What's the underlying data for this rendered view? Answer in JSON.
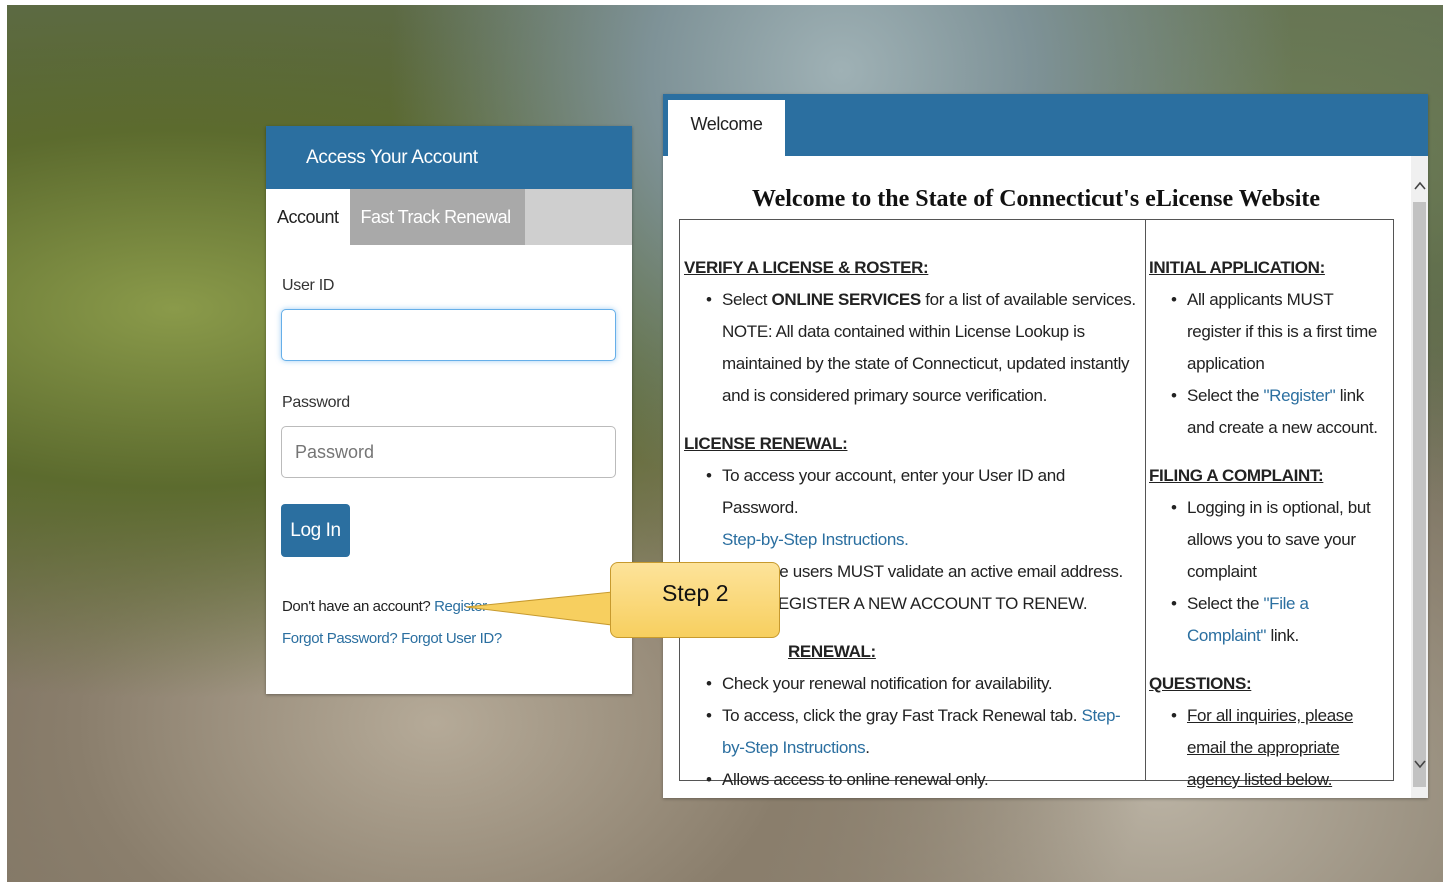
{
  "login": {
    "title": "Access Your Account",
    "tabs": [
      "Account",
      "Fast Track Renewal"
    ],
    "userid_label": "User ID",
    "userid_value": "",
    "password_label": "Password",
    "password_placeholder": "Password",
    "login_button": "Log In",
    "no_account_text": "Don't have an account?",
    "register_link": "Register",
    "forgot_password": "Forgot Password?",
    "forgot_userid": "Forgot User ID?"
  },
  "welcome": {
    "tab": "Welcome",
    "title": "Welcome to the State of Connecticut's eLicense Website",
    "left": {
      "verify_heading": "VERIFY A LICENSE & ROSTER:",
      "verify_b1_pre": "Select ",
      "verify_b1_bold": "ONLINE SERVICES",
      "verify_b1_post": " for a list of available services. NOTE: All data contained within License Lookup is maintained by the state of Connecticut, updated instantly and is considered primary source verification.",
      "renewal_heading": "LICENSE RENEWAL:",
      "renewal_b1": "To access your account, enter your User ID and Password.",
      "renewal_b1_link": "Step-by-Step Instructions.",
      "renewal_b2a": "First time users MUST validate an active email address.",
      "renewal_b2b": "REGISTER A NEW ACCOUNT TO RENEW.",
      "fast_heading": "RENEWAL:",
      "fast_b1": "Check your renewal notification for availability.",
      "fast_b2": "To access, click the gray Fast Track Renewal tab.",
      "fast_b2_link": "Step-by-Step Instructions",
      "fast_b2_end": ".",
      "fast_b3": "Allows access to online renewal only."
    },
    "right": {
      "initial_heading": "INITIAL APPLICATION:",
      "initial_b1": "All applicants MUST register if this is a first time application",
      "initial_b2_pre": "Select the ",
      "initial_b2_link": "\"Register\"",
      "initial_b2_post": " link and create a new account.",
      "complaint_heading": "FILING A COMPLAINT:",
      "complaint_b1": "Logging in is optional, but allows you to save your complaint",
      "complaint_b2_pre": "Select the ",
      "complaint_b2_link": "\"File a Complaint\"",
      "complaint_b2_post": " link.",
      "questions_heading": "QUESTIONS:",
      "questions_b1": "For all inquiries, please email the appropriate agency listed below."
    }
  },
  "callout": {
    "text": "Step 2"
  },
  "icons": {
    "scroll_up": "chevron-up-icon",
    "scroll_down": "chevron-down-icon"
  },
  "colors": {
    "brand_blue": "#2b6fa0",
    "callout_yellow": "#f7cf5f",
    "tab_gray": "#a9a9a9"
  }
}
